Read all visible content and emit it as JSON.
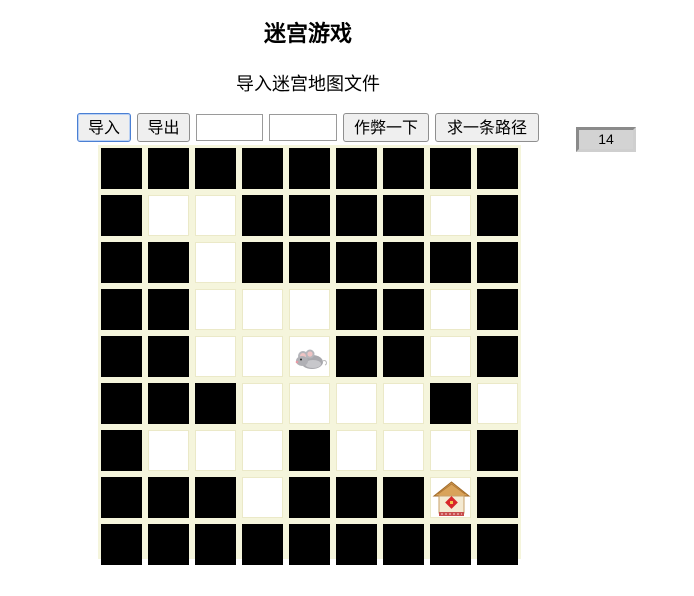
{
  "header": {
    "title": "迷宫游戏",
    "subtitle": "导入迷宫地图文件"
  },
  "toolbar": {
    "import_label": "导入",
    "export_label": "导出",
    "input1_value": "",
    "input2_value": "",
    "cheat_label": "作弊一下",
    "find_path_label": "求一条路径"
  },
  "counter": {
    "value": "14"
  },
  "maze": {
    "rows": 9,
    "cols": 9,
    "grid": [
      "#########",
      "#..####.#",
      "##.######",
      "##...##.#",
      "##..M##.#",
      "###....#.#",
      "#...#...#",
      "###.###H#",
      "#########"
    ],
    "legend": {
      "#": "wall",
      ".": "path",
      "M": "mouse",
      "H": "house"
    },
    "colors": {
      "wall": "#000000",
      "path": "#ffffff",
      "gap": "#f5f5dc"
    },
    "mouse_icon": "mouse-icon",
    "house_icon": "house-icon"
  }
}
